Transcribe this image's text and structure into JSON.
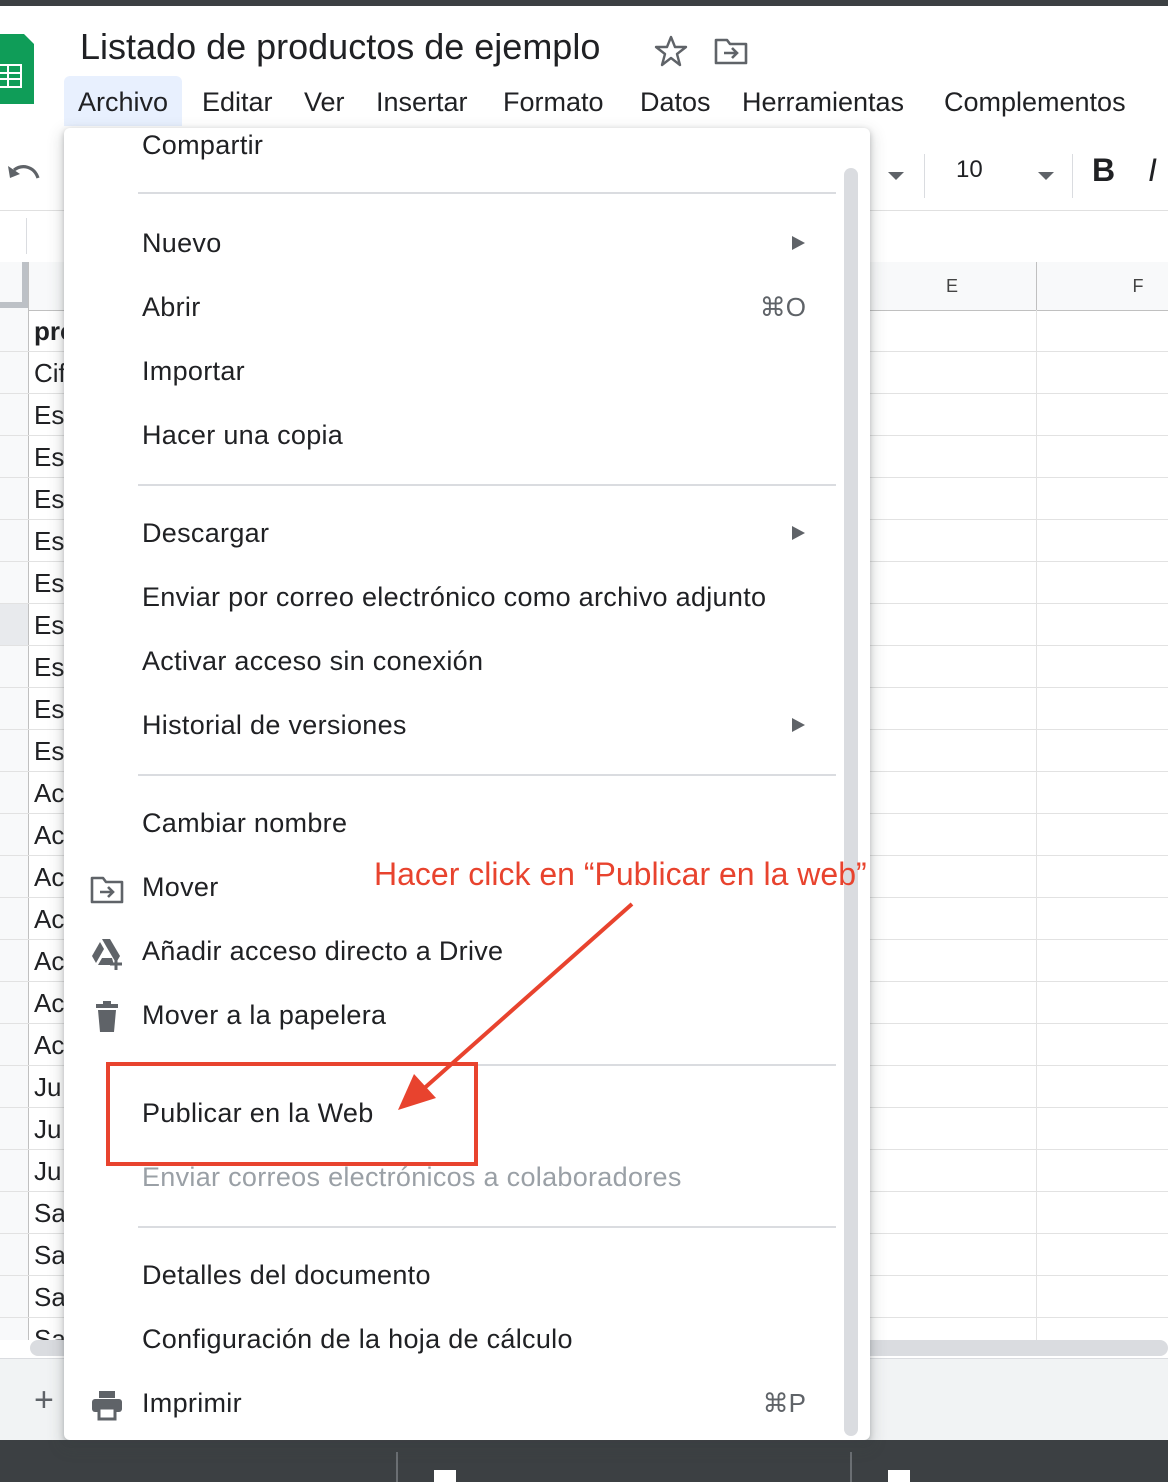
{
  "document": {
    "title": "Listado de productos de ejemplo",
    "icons": [
      "sheets-logo",
      "star-icon",
      "move-folder-icon"
    ]
  },
  "menubar": {
    "items": [
      "Archivo",
      "Editar",
      "Ver",
      "Insertar",
      "Formato",
      "Datos",
      "Herramientas",
      "Complementos"
    ],
    "active": "Archivo"
  },
  "toolbar": {
    "font_size": "10",
    "bold_label": "B",
    "italic_label": "I"
  },
  "grid": {
    "columns": [
      "E",
      "F"
    ],
    "column_a_cells": [
      "pro",
      "Cif",
      "Es",
      "Es",
      "Es",
      "Es",
      "Es",
      "Es",
      "Es",
      "Es",
      "Es",
      "Ac",
      "Ac",
      "Ac",
      "Ac",
      "Ac",
      "Ac",
      "Ac",
      "Ju",
      "Ju",
      "Ju",
      "Sa",
      "Sa",
      "Sa",
      "Sa"
    ]
  },
  "sheet_bar": {
    "add_label": "+"
  },
  "file_menu": {
    "share": "Compartir",
    "new": "Nuevo",
    "open": "Abrir",
    "open_shortcut": "⌘O",
    "import": "Importar",
    "make_copy": "Hacer una copia",
    "download": "Descargar",
    "email_attachment": "Enviar por correo electrónico como archivo adjunto",
    "offline": "Activar acceso sin conexión",
    "version_history": "Historial de versiones",
    "rename": "Cambiar nombre",
    "move": "Mover",
    "add_shortcut": "Añadir acceso directo a Drive",
    "trash": "Mover a la papelera",
    "publish": "Publicar en la Web",
    "email_collaborators": "Enviar correos electrónicos a colaboradores",
    "details": "Detalles del documento",
    "settings": "Configuración de la hoja de cálculo",
    "print": "Imprimir",
    "print_shortcut": "⌘P"
  },
  "annotation": {
    "text": "Hacer click en “Publicar en la web”",
    "color": "#e8432e"
  },
  "colors": {
    "sheets_green": "#0f9d58",
    "active_menu_bg": "#e8f0fe"
  }
}
